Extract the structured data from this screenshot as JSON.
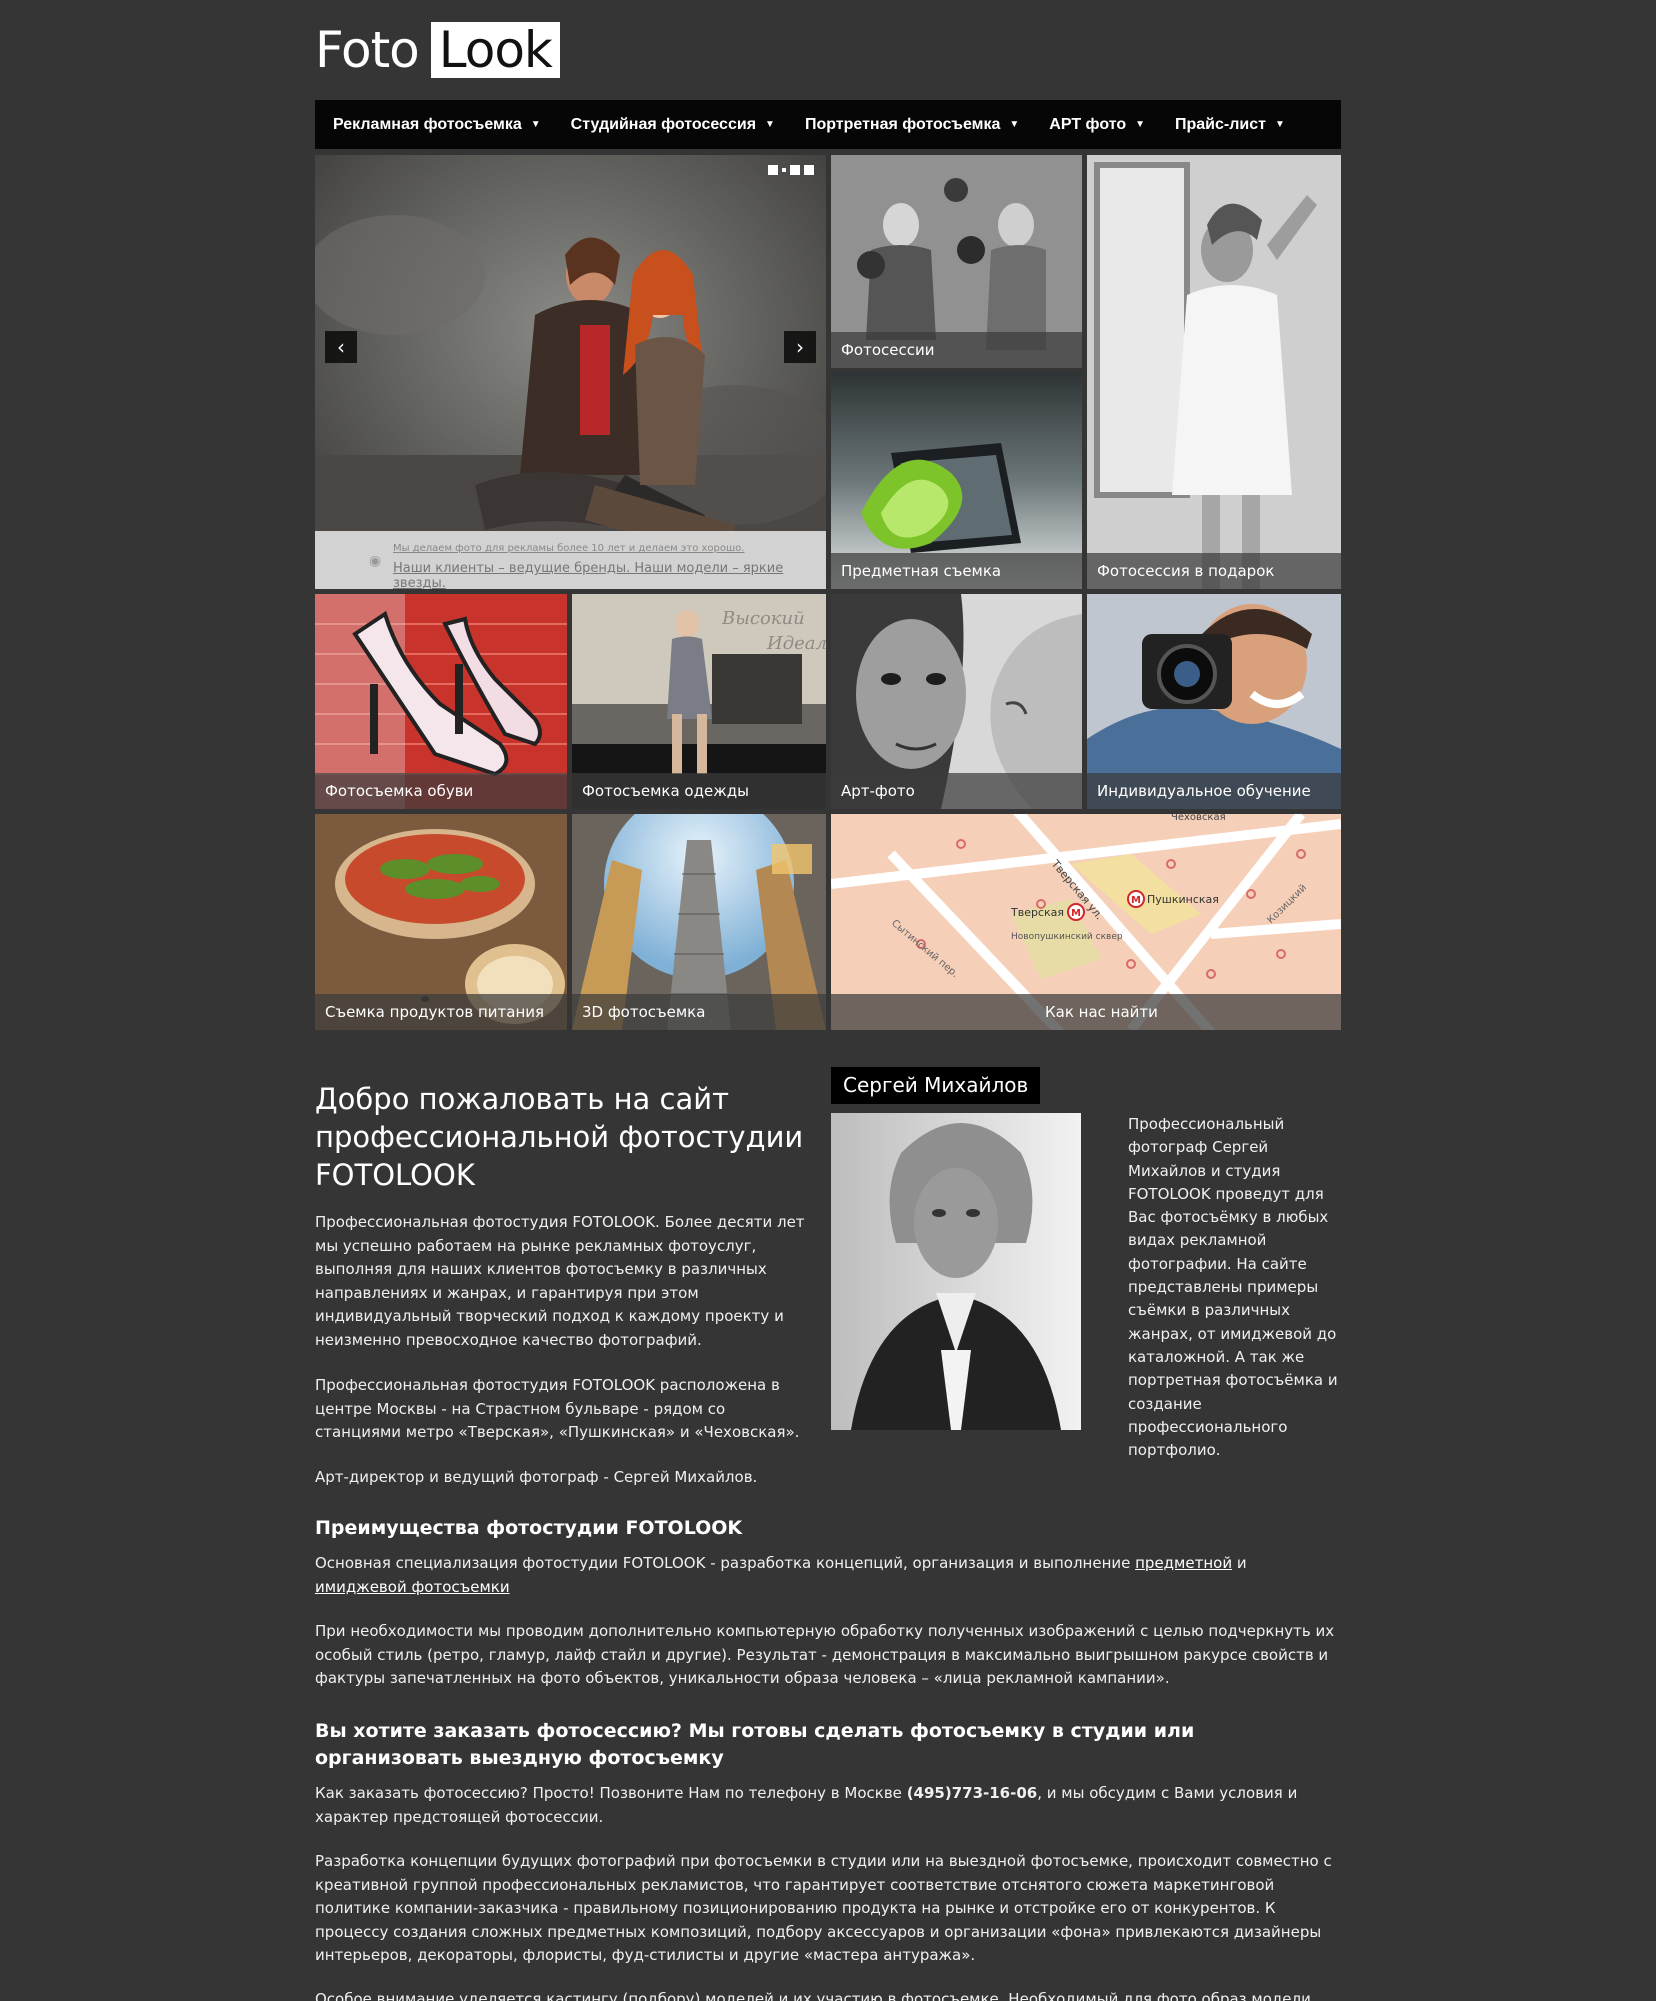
{
  "logo": {
    "part1": "Foto",
    "part2": "Look"
  },
  "nav": {
    "items": [
      {
        "label": "Рекламная фотосъемка"
      },
      {
        "label": "Студийная фотосессия"
      },
      {
        "label": "Портретная фотосъемка"
      },
      {
        "label": "АРТ фото"
      },
      {
        "label": "Прайс-лист"
      }
    ],
    "chevron": "⌄"
  },
  "slider": {
    "line1": "Мы делаем фото для рекламы более 10 лет и делаем это хорошо.",
    "line2": "Наши клиенты – ведущие бренды. Наши модели – яркие звезды.",
    "prev": "‹",
    "next": "›"
  },
  "tiles": {
    "photosessions": "Фотосессии",
    "product": "Предметная съемка",
    "gift": "Фотосессия в подарок",
    "shoes": "Фотосъемка обуви",
    "clothes": "Фотосъемка одежды",
    "art": "Арт-фото",
    "training": "Индивидуальное обучение",
    "food": "Съемка продуктов питания",
    "threed": "3D фотосъемка",
    "map": "Как нас найти"
  },
  "map_labels": {
    "tverskaya_ul": "Тверская ул.",
    "tverskaya_m": "Тверская",
    "pushkinskaya_m": "Пушкинская",
    "chekhovskaya": "Чеховская",
    "square": "Новопушкинский сквер",
    "sytinsky": "Сытинский пер.",
    "kozitsky": "Козицкий"
  },
  "main": {
    "title": "Добро пожаловать на сайт профессиональной фотостудии FOTOLOOK",
    "p1": "Профессиональная фотостудия FOTOLOOK. Более десяти лет мы успешно работаем на рынке рекламных фотоуслуг, выполняя для наших клиентов фотосъемку в различных направлениях и жанрах, и гарантируя при этом индивидуальный творческий подход к каждому проекту и неизменно превосходное качество фотографий.",
    "p2": "Профессиональная фотостудия FOTOLOOK расположена в центре Москвы - на Страстном бульваре - рядом со станциями метро «Тверская», «Пушкинская» и «Чеховская».",
    "p3": "Арт-директор и ведущий фотограф - Сергей Михайлов.",
    "h_adv": "Преимущества фотостудии FOTOLOOK",
    "adv_p1_a": "Основная специализация фотостудии FOTOLOOK - разработка концепций, организация и выполнение ",
    "adv_link1": "предметной",
    "adv_p1_and": " и ",
    "adv_link2": "имиджевой фотосъемки",
    "adv_p2": "При необходимости мы проводим дополнительно компьютерную обработку полученных изображений с целью подчеркнуть их особый стиль (ретро, гламур, лайф стайл и другие). Результат - демонстрация в максимально выигрышном ракурсе свойств и фактуры запечатленных на фото объектов, уникальности образа человека – «лица рекламной кампании».",
    "h_order": "Вы хотите заказать фотосессию? Мы готовы сделать фотосъемку в студии или организовать выездную фотосъемку",
    "order_a": "Как заказать фотосессию? Просто! Позвоните Нам по телефону в Москве ",
    "phone": "(495)773-16-06",
    "order_b": ", и мы обсудим с Вами условия и характер предстоящей фотосессии.",
    "p_concept": "Разработка концепции будущих фотографий при фотосъемки в студии или на выездной фотосъемке, происходит совместно с креативной группой профессиональных рекламистов, что гарантирует соответствие отснятого сюжета маркетинговой политике компании-заказчика - правильному позиционированию продукта на рынке и отстройке его от конкурентов. К процессу создания сложных предметных композиций, подбору аксессуаров и организации «фона» привлекаются дизайнеры интерьеров, декораторы, флористы, фуд-стилисты и другие «мастера антуража».",
    "p_casting": "Особое внимание уделяется кастингу (подбору) моделей и их участию в фотосъемке. Необходимый для фото образ модели создают"
  },
  "author": {
    "name": "Сергей Михайлов",
    "text": "Профессиональный фотограф Сергей Михайлов и студия FOTOLOOK проведут для Вас фотосъёмку в любых видах рекламной фотографии. На сайте представлены примеры съёмки в различных жанрах, от имиджевой до каталожной. А так же портретная фотосъёмка и создание профессионального портфолио."
  },
  "colors": {
    "background": "#353535",
    "nav": "#060606",
    "map": "#f5cfb8"
  }
}
